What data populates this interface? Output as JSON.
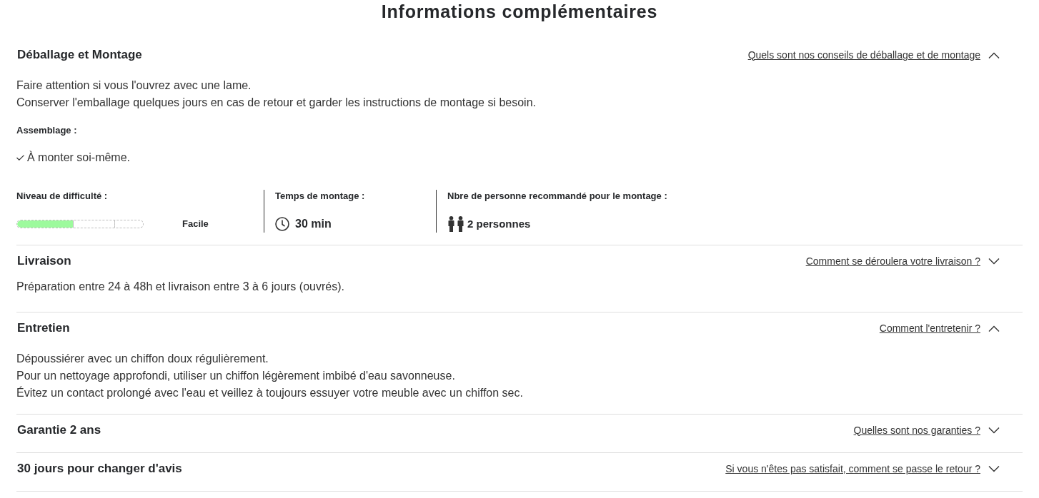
{
  "title": "Informations complémentaires",
  "sections": [
    {
      "title": "Déballage et Montage",
      "link": "Quels sont nos conseils de déballage et de montage",
      "expanded": true,
      "paragraphs": [
        "Faire attention si vous l'ouvrez avec une lame.",
        "Conserver l'emballage quelques jours en cas de retour et garder les instructions de montage si besoin."
      ],
      "assembly": {
        "label": "Assemblage :",
        "items": [
          "À monter soi-même."
        ]
      },
      "stats": [
        {
          "kind": "difficulty",
          "label": "Niveau de difficulté :",
          "level": 0.45,
          "value": "Facile"
        },
        {
          "kind": "time",
          "label": "Temps de montage :",
          "value": "30 min"
        },
        {
          "kind": "people",
          "label": "Nbre de personne recommandé pour le montage :",
          "value": "2 personnes"
        }
      ]
    },
    {
      "title": "Livraison",
      "link": "Comment se déroulera votre livraison ?",
      "expanded": false,
      "paragraphs": [
        "Préparation entre 24 à 48h et livraison entre 3 à 6 jours (ouvrés)."
      ]
    },
    {
      "title": "Entretien",
      "link": "Comment l'entretenir ?",
      "expanded": true,
      "paragraphs": [
        "Dépoussiérer avec un chiffon doux régulièrement.",
        "Pour un nettoyage approfondi, utiliser un chiffon légèrement imbibé d'eau savonneuse.",
        "Évitez un contact prolongé avec l'eau et veillez à toujours essuyer votre meuble avec un chiffon sec."
      ]
    },
    {
      "title": "Garantie 2 ans",
      "link": "Quelles sont nos garanties ?",
      "expanded": false
    },
    {
      "title": "30 jours pour changer d'avis",
      "link": "Si vous n'êtes pas satisfait, comment se passe le retour ?",
      "expanded": false
    }
  ]
}
